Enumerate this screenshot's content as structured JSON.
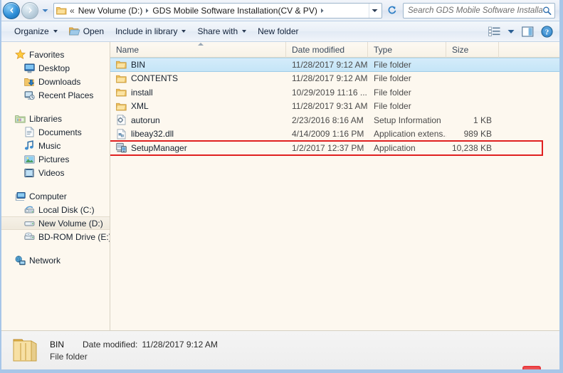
{
  "addressbar": {
    "back_tooltip": "Back",
    "forward_tooltip": "Forward",
    "chev_prev": "«",
    "crumbs": [
      "New Volume (D:)",
      "GDS Mobile Software Installation(CV & PV)"
    ],
    "separator": "▸",
    "search_placeholder": "Search GDS Mobile Software Installati..."
  },
  "toolbar": {
    "organize": "Organize",
    "open": "Open",
    "include_in_library": "Include in library",
    "share_with": "Share with",
    "new_folder": "New folder"
  },
  "navpane": {
    "groups": [
      {
        "root": "Favorites",
        "root_icon": "star-icon",
        "items": [
          {
            "label": "Desktop",
            "icon": "desktop-icon"
          },
          {
            "label": "Downloads",
            "icon": "downloads-icon"
          },
          {
            "label": "Recent Places",
            "icon": "recent-places-icon"
          }
        ]
      },
      {
        "root": "Libraries",
        "root_icon": "libraries-icon",
        "items": [
          {
            "label": "Documents",
            "icon": "documents-icon"
          },
          {
            "label": "Music",
            "icon": "music-icon"
          },
          {
            "label": "Pictures",
            "icon": "pictures-icon"
          },
          {
            "label": "Videos",
            "icon": "videos-icon"
          }
        ]
      },
      {
        "root": "Computer",
        "root_icon": "computer-icon",
        "items": [
          {
            "label": "Local Disk (C:)",
            "icon": "harddisk-icon",
            "selected": false
          },
          {
            "label": "New Volume (D:)",
            "icon": "drive-icon",
            "selected": true
          },
          {
            "label": "BD-ROM Drive (E:) C",
            "icon": "optical-drive-icon",
            "selected": false
          }
        ]
      },
      {
        "root": "Network",
        "root_icon": "network-icon",
        "items": []
      }
    ]
  },
  "filelist": {
    "columns": [
      {
        "key": "name",
        "label": "Name",
        "sorted": "asc"
      },
      {
        "key": "date",
        "label": "Date modified"
      },
      {
        "key": "type",
        "label": "Type"
      },
      {
        "key": "size",
        "label": "Size"
      }
    ],
    "rows": [
      {
        "name": "BIN",
        "date": "11/28/2017 9:12 AM",
        "type": "File folder",
        "size": "",
        "icon": "folder-icon",
        "selected": true
      },
      {
        "name": "CONTENTS",
        "date": "11/28/2017 9:12 AM",
        "type": "File folder",
        "size": "",
        "icon": "folder-icon",
        "selected": false
      },
      {
        "name": "install",
        "date": "10/29/2019 11:16 ...",
        "type": "File folder",
        "size": "",
        "icon": "folder-icon",
        "selected": false
      },
      {
        "name": "XML",
        "date": "11/28/2017 9:31 AM",
        "type": "File folder",
        "size": "",
        "icon": "folder-icon",
        "selected": false
      },
      {
        "name": "autorun",
        "date": "2/23/2016 8:16 AM",
        "type": "Setup Information",
        "size": "1 KB",
        "icon": "setup-info-icon",
        "selected": false
      },
      {
        "name": "libeay32.dll",
        "date": "4/14/2009 1:16 PM",
        "type": "Application extens...",
        "size": "989 KB",
        "icon": "dll-icon",
        "selected": false
      },
      {
        "name": "SetupManager",
        "date": "1/2/2017 12:37 PM",
        "type": "Application",
        "size": "10,238 KB",
        "icon": "application-icon",
        "selected": false,
        "annotated": true
      }
    ]
  },
  "details": {
    "name": "BIN",
    "date_modified_label": "Date modified:",
    "date_modified_value": "11/28/2017 9:12 AM",
    "type": "File folder",
    "icon": "folder-large-icon"
  },
  "colors": {
    "annotation_red": "#e02020",
    "selection_blue": "#c5e5f7",
    "window_background": "#fdf8ef",
    "chrome_blue": "#a8c6e8"
  }
}
